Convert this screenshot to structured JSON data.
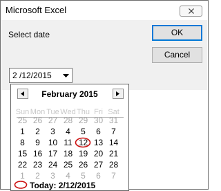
{
  "window": {
    "title": "Microsoft Excel"
  },
  "dialog": {
    "prompt": "Select date",
    "ok_label": "OK",
    "cancel_label": "Cancel"
  },
  "date_picker": {
    "value": "2 /12/2015"
  },
  "calendar": {
    "month_label": "February 2015",
    "weekdays": [
      "Sun",
      "Mon",
      "Tue",
      "Wed",
      "Thu",
      "Fri",
      "Sat"
    ],
    "weeks": [
      [
        "25",
        "26",
        "27",
        "28",
        "29",
        "30",
        "31"
      ],
      [
        "1",
        "2",
        "3",
        "4",
        "5",
        "6",
        "7"
      ],
      [
        "8",
        "9",
        "10",
        "11",
        "12",
        "13",
        "14"
      ],
      [
        "15",
        "16",
        "17",
        "18",
        "19",
        "20",
        "21"
      ],
      [
        "22",
        "23",
        "24",
        "25",
        "26",
        "27",
        "28"
      ],
      [
        "1",
        "2",
        "3",
        "4",
        "5",
        "6",
        "7"
      ]
    ],
    "selected_day": "12",
    "today_label": "Today: 2/12/2015",
    "circle_color": "#cc1111"
  },
  "icons": {
    "close": "close-icon",
    "dropdown": "chevron-down-icon",
    "prev": "chevron-left-icon",
    "next": "chevron-right-icon",
    "today_marker": "today-circle-icon"
  }
}
